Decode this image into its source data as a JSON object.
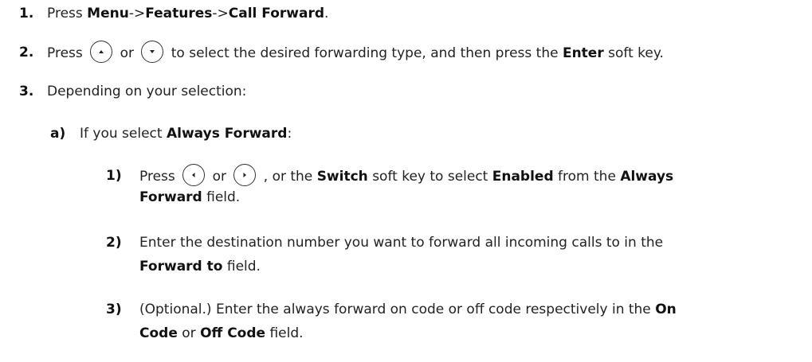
{
  "step1": {
    "number": "1.",
    "press": "Press",
    "menu": "Menu",
    "arrow1": "->",
    "features": "Features",
    "arrow2": "->",
    "call_forward": "Call Forward",
    "end": "."
  },
  "step2": {
    "number": "2.",
    "press": "Press",
    "or": "or",
    "rest1": "to select the desired forwarding type, and then press the",
    "enter": "Enter",
    "rest2": "soft key.",
    "icons": [
      "up-key-icon",
      "down-key-icon"
    ]
  },
  "step3": {
    "number": "3.",
    "text": "Depending on your selection:"
  },
  "substep_a": {
    "number": "a)",
    "text": "If you select",
    "always_forward": "Always Forward",
    "end": ":"
  },
  "sub1": {
    "number": "1)",
    "press": "Press",
    "or": "or",
    "comma_text": ", or the",
    "switch": "Switch",
    "soft_key_text": "soft key to select",
    "enabled": "Enabled",
    "from_text": "from the",
    "always": "Always",
    "forward": "Forward",
    "field": "field.",
    "icons": [
      "left-key-icon",
      "right-key-icon"
    ]
  },
  "sub2": {
    "number": "2)",
    "line1": "Enter the destination number you want to forward all incoming calls to in the",
    "forward_to": "Forward to",
    "field": "field."
  },
  "sub3": {
    "number": "3)",
    "line1": "(Optional.) Enter the always forward on code or off code respectively in the",
    "on": "On",
    "code": "Code",
    "or": "or",
    "off_code": "Off Code",
    "field": "field."
  }
}
